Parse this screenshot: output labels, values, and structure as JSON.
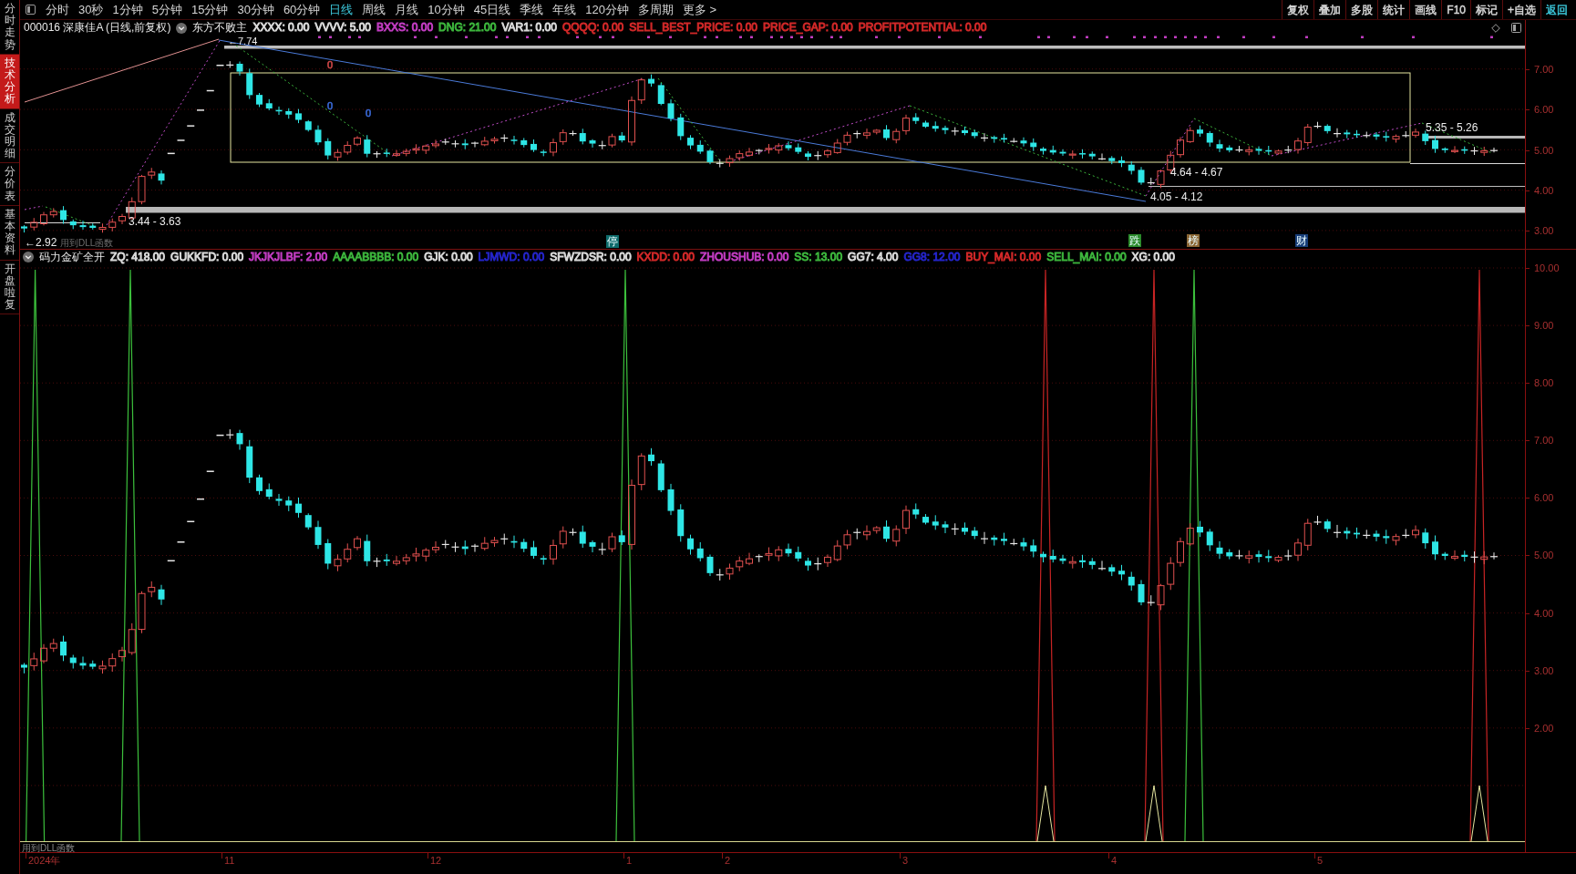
{
  "side_tabs": [
    {
      "label": "分时走势",
      "selected": false
    },
    {
      "label": "技术分析",
      "selected": true
    },
    {
      "label": "成交明细",
      "selected": false
    },
    {
      "label": "分价表",
      "selected": false
    },
    {
      "label": "基本资料",
      "selected": false
    },
    {
      "label": "开盘啦复",
      "selected": false
    }
  ],
  "toolbar": {
    "periods": [
      {
        "label": "分时",
        "selected": false
      },
      {
        "label": "30秒",
        "selected": false
      },
      {
        "label": "1分钟",
        "selected": false
      },
      {
        "label": "5分钟",
        "selected": false
      },
      {
        "label": "15分钟",
        "selected": false
      },
      {
        "label": "30分钟",
        "selected": false
      },
      {
        "label": "60分钟",
        "selected": false
      },
      {
        "label": "日线",
        "selected": true
      },
      {
        "label": "周线",
        "selected": false
      },
      {
        "label": "月线",
        "selected": false
      },
      {
        "label": "10分钟",
        "selected": false
      },
      {
        "label": "45日线",
        "selected": false
      },
      {
        "label": "季线",
        "selected": false
      },
      {
        "label": "年线",
        "selected": false
      },
      {
        "label": "120分钟",
        "selected": false
      },
      {
        "label": "多周期",
        "selected": false
      },
      {
        "label": "更多 >",
        "selected": false
      }
    ],
    "actions": [
      {
        "label": "复权",
        "color": "#d8d8d8"
      },
      {
        "label": "叠加",
        "color": "#d8d8d8"
      },
      {
        "label": "多股",
        "color": "#d8d8d8"
      },
      {
        "label": "统计",
        "color": "#d8d8d8"
      },
      {
        "label": "画线",
        "color": "#d8d8d8"
      },
      {
        "label": "F10",
        "color": "#d8d8d8"
      },
      {
        "label": "标记",
        "color": "#d8d8d8"
      },
      {
        "label": "+自选",
        "color": "#d8d8d8"
      },
      {
        "label": "返回",
        "color": "#3cc8dc"
      }
    ]
  },
  "price_panel": {
    "security": "000016 深康佳A (日线,前复权)",
    "formula": "东方不败主",
    "values": [
      {
        "text": "XXXX: 0.00",
        "color": "#d8d8d8"
      },
      {
        "text": "VVVV: 5.00",
        "color": "#d8d8d8"
      },
      {
        "text": "BXXS: 0.00",
        "color": "#c03cc0"
      },
      {
        "text": "DNG: 21.00",
        "color": "#3cb43c"
      },
      {
        "text": "VAR1: 0.00",
        "color": "#d8d8d8"
      },
      {
        "text": "QQQQ: 0.00",
        "color": "#d02828"
      },
      {
        "text": "SELL_BEST_PRICE: 0.00",
        "color": "#d02828"
      },
      {
        "text": "PRICE_GAP: 0.00",
        "color": "#d02828"
      },
      {
        "text": "PROFITPOTENTIAL: 0.00",
        "color": "#d02828"
      }
    ],
    "price_labels": [
      "←7.74",
      "3.44 - 3.63",
      "←2.92",
      "4.64 - 4.67",
      "4.05 - 4.12",
      "5.35 - 5.26"
    ],
    "signal_digits": [
      {
        "text": "0",
        "color": "#d04848"
      },
      {
        "text": "0",
        "color": "#3a6ad8"
      },
      {
        "text": "0",
        "color": "#3a6ad8"
      }
    ],
    "event_markers": [
      {
        "text": "停",
        "color": "#0d6b6b"
      },
      {
        "text": "跌",
        "color": "#2a8a2a"
      },
      {
        "text": "榜",
        "color": "#8a6533"
      },
      {
        "text": "财",
        "color": "#173d78"
      }
    ],
    "note": "用到DLL函数",
    "axis": [
      "7.00",
      "6.00",
      "5.00",
      "4.00",
      "3.00"
    ]
  },
  "indicator_panel": {
    "formula": "码力金矿全开",
    "values": [
      {
        "text": "ZQ: 418.00",
        "color": "#d8d8d8"
      },
      {
        "text": "GUKKFD: 0.00",
        "color": "#d8d8d8"
      },
      {
        "text": "JKJKJLBF: 2.00",
        "color": "#c03cc0"
      },
      {
        "text": "AAAABBBB: 0.00",
        "color": "#3cb43c"
      },
      {
        "text": "GJK: 0.00",
        "color": "#d8d8d8"
      },
      {
        "text": "LJMWD: 0.00",
        "color": "#2424c8"
      },
      {
        "text": "SFWZDSR: 0.00",
        "color": "#d8d8d8"
      },
      {
        "text": "KXDD: 0.00",
        "color": "#d02828"
      },
      {
        "text": "ZHOUSHUB: 0.00",
        "color": "#c03cc0"
      },
      {
        "text": "SS: 13.00",
        "color": "#3cb43c"
      },
      {
        "text": "GG7: 4.00",
        "color": "#d8d8d8"
      },
      {
        "text": "GG8: 12.00",
        "color": "#2424c8"
      },
      {
        "text": "BUY_MAI: 0.00",
        "color": "#d02828"
      },
      {
        "text": "SELL_MAI: 0.00",
        "color": "#3cb43c"
      },
      {
        "text": "XG: 0.00",
        "color": "#d8d8d8"
      }
    ],
    "axis": [
      "10.00",
      "9.00",
      "8.00",
      "7.00",
      "6.00",
      "5.00",
      "4.00",
      "3.00",
      "2.00"
    ],
    "note": "用到DLL函数"
  },
  "time_axis": [
    "2024年",
    "11",
    "12",
    "1",
    "2",
    "3",
    "4",
    "5"
  ]
}
